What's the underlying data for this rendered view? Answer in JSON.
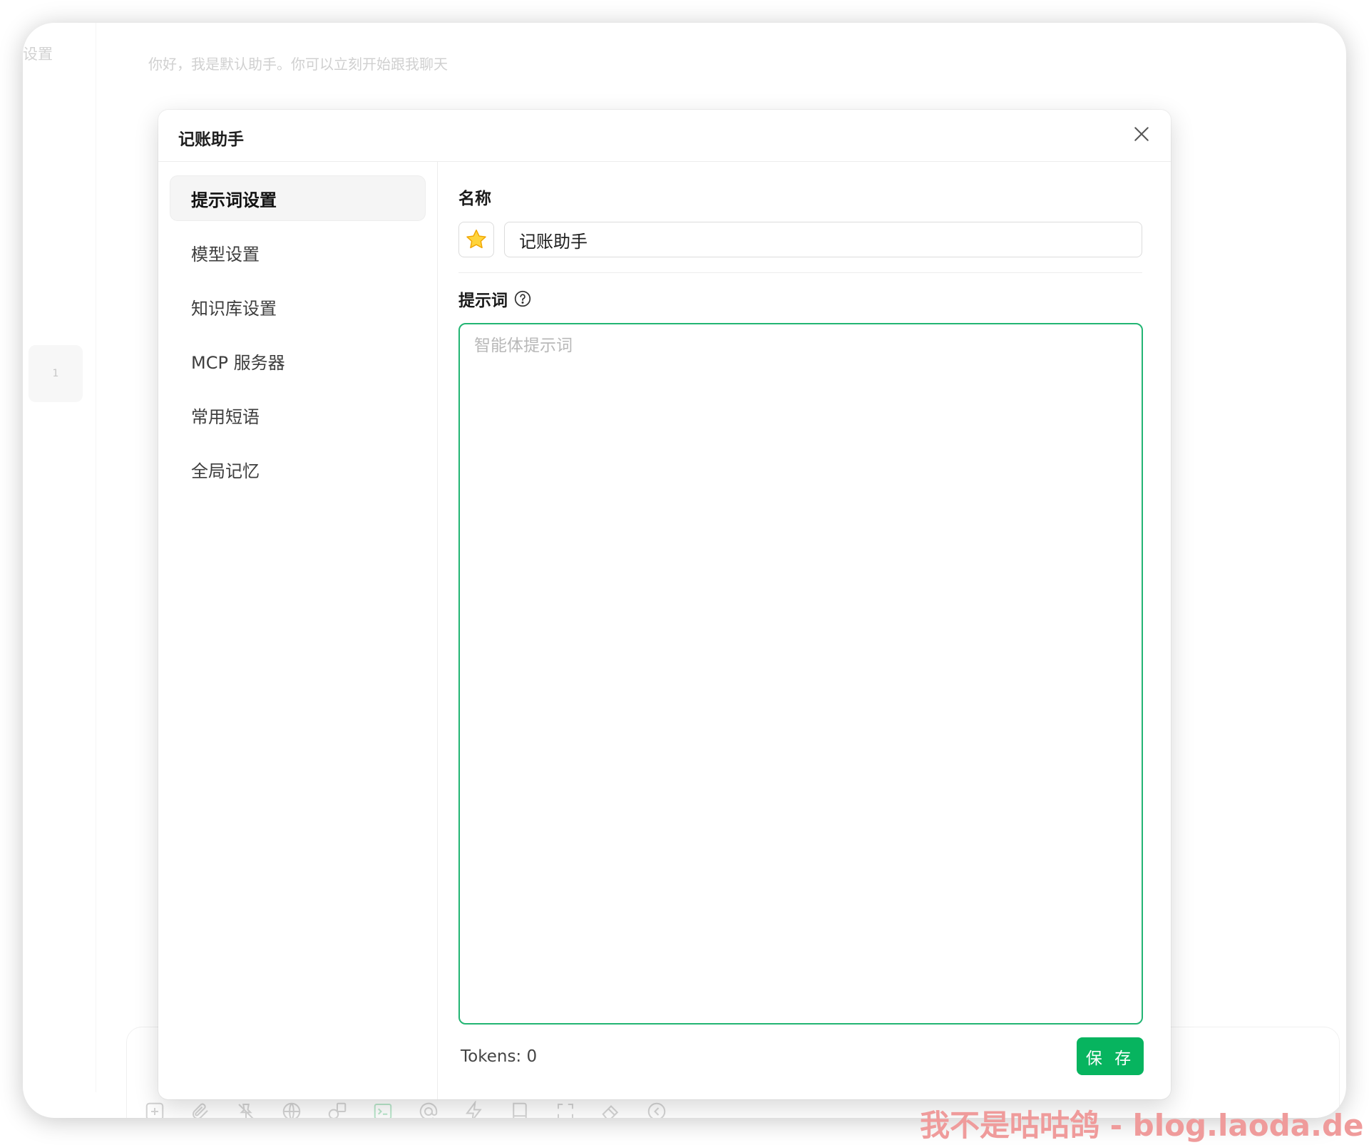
{
  "background_app": {
    "sidebar_title": "设置",
    "greeting": "你好，我是默认助手。你可以立刻开始跟我聊天",
    "topic_count": "1",
    "toolbar_icons": [
      "new-topic-icon",
      "attachment-icon",
      "pin-icon",
      "globe-icon",
      "shapes-icon",
      "terminal-icon",
      "at-sign-icon",
      "lightning-icon",
      "book-icon",
      "expand-icon",
      "eraser-icon",
      "at-circle-icon"
    ]
  },
  "modal": {
    "title": "记账助手",
    "nav": [
      {
        "label": "提示词设置",
        "active": true
      },
      {
        "label": "模型设置",
        "active": false
      },
      {
        "label": "知识库设置",
        "active": false
      },
      {
        "label": "MCP 服务器",
        "active": false
      },
      {
        "label": "常用短语",
        "active": false
      },
      {
        "label": "全局记忆",
        "active": false
      }
    ],
    "name_label": "名称",
    "emoji": "star-emoji",
    "name_value": "记账助手",
    "prompt_label": "提示词",
    "prompt_placeholder": "智能体提示词",
    "prompt_value": "",
    "tokens_text": "Tokens: 0",
    "save_label": "保 存"
  },
  "colors": {
    "accent": "#07b45f",
    "focus_border": "#22b573",
    "watermark": "#ef9b9b"
  },
  "watermark": "我不是咕咕鸽 - blog.laoda.de"
}
